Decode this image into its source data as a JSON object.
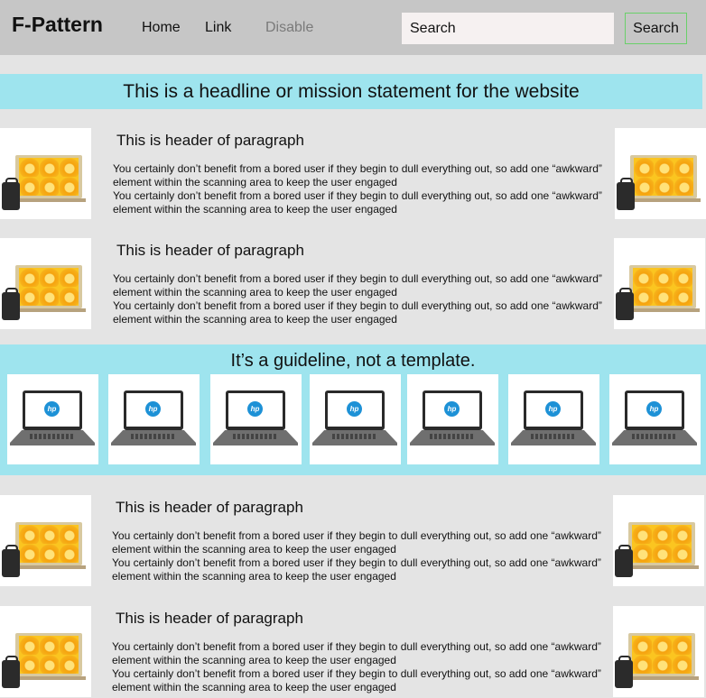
{
  "navbar": {
    "brand": "F-Pattern",
    "links": [
      "Home",
      "Link"
    ],
    "disabled_link": "Disable",
    "search_placeholder": "Search",
    "search_button": "Search"
  },
  "headline": "This is a headline or mission statement for the website",
  "sections_top": [
    {
      "header": "This is header of paragraph",
      "body": [
        "You certainly don’t benefit from a bored user if they begin to dull everything out, so add one “awkward” element within the scanning area to keep the user engaged",
        "You certainly don’t benefit from a bored user if they begin to dull everything out, so add one “awkward” element within the scanning area to keep the user engaged"
      ]
    },
    {
      "header": "This is header of paragraph",
      "body": [
        "You certainly don’t benefit from a bored user if they begin to dull everything out, so add one “awkward” element within the scanning area to keep the user engaged",
        "You certainly don’t benefit from a bored user if they begin to dull everything out, so add one “awkward” element within the scanning area to keep the user engaged"
      ]
    }
  ],
  "guideline": {
    "title": "It’s a guideline, not a template.",
    "logo_text": "hp"
  },
  "sections_bottom": [
    {
      "header": "This is header of paragraph",
      "body": [
        "You certainly don’t benefit from a bored user if they begin to dull everything out, so add one “awkward” element within the scanning area to keep the user engaged",
        "You certainly don’t benefit from a bored user if they begin to dull everything out, so add one “awkward” element within the scanning area to keep the user engaged"
      ]
    },
    {
      "header": "This is header of paragraph",
      "body": [
        "You certainly don’t benefit from a bored user if they begin to dull everything out, so add one “awkward” element within the scanning area to keep the user engaged",
        "You certainly don’t benefit from a bored user if they begin to dull everything out, so add one “awkward” element within the scanning area to keep the user engaged"
      ]
    }
  ],
  "colors": {
    "page_bg": "#e4e4e4",
    "navbar_bg": "#c6c6c6",
    "accent_band": "#9ee4ee",
    "search_button_border": "#6ad06a"
  },
  "icons": {
    "section_image": "orange-laptop-with-bag-image",
    "guide_image": "hp-laptop-image"
  }
}
